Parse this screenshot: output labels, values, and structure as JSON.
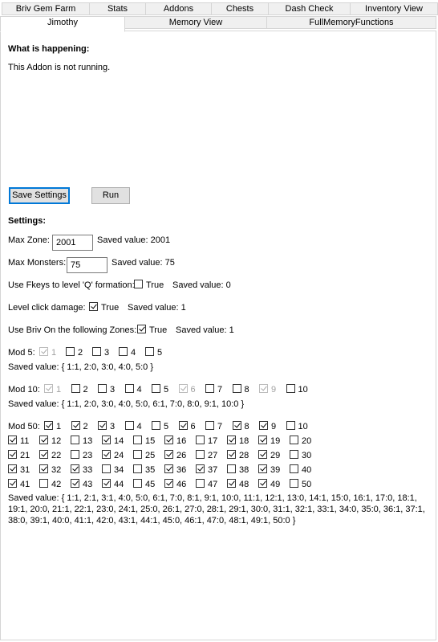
{
  "tabs_row1": [
    "Briv Gem Farm",
    "Stats",
    "Addons",
    "Chests",
    "Dash Check",
    "Inventory View"
  ],
  "tabs_row2": [
    "Jimothy",
    "Memory View",
    "FullMemoryFunctions"
  ],
  "status": {
    "heading": "What is happening:",
    "message": "This Addon is not running."
  },
  "buttons": {
    "save": "Save Settings",
    "run": "Run"
  },
  "settings": {
    "heading": "Settings:",
    "max_zone": {
      "label": "Max Zone:",
      "value": "2001",
      "saved": "Saved value: 2001"
    },
    "max_monsters": {
      "label": "Max Monsters:",
      "value": "75",
      "saved": "Saved value: 75"
    },
    "fkeys": {
      "label": "Use Fkeys to level 'Q' formation:",
      "checkbox_label": "True",
      "checked": false,
      "saved": "Saved value: 0"
    },
    "click_damage": {
      "label": "Level click damage:",
      "checkbox_label": "True",
      "checked": true,
      "saved": "Saved value: 1"
    },
    "briv_zones": {
      "label": "Use Briv On the following Zones:",
      "checkbox_label": "True",
      "checked": true,
      "saved": "Saved value: 1"
    }
  },
  "mod5": {
    "label": "Mod 5:",
    "items": [
      {
        "n": "1",
        "checked": true,
        "disabled": true
      },
      {
        "n": "2",
        "checked": false
      },
      {
        "n": "3",
        "checked": false
      },
      {
        "n": "4",
        "checked": false
      },
      {
        "n": "5",
        "checked": false
      }
    ],
    "saved": "Saved value: { 1:1, 2:0, 3:0, 4:0, 5:0 }"
  },
  "mod10": {
    "label": "Mod 10:",
    "items": [
      {
        "n": "1",
        "checked": true,
        "disabled": true
      },
      {
        "n": "2",
        "checked": false
      },
      {
        "n": "3",
        "checked": false
      },
      {
        "n": "4",
        "checked": false
      },
      {
        "n": "5",
        "checked": false
      },
      {
        "n": "6",
        "checked": true,
        "disabled": true
      },
      {
        "n": "7",
        "checked": false
      },
      {
        "n": "8",
        "checked": false
      },
      {
        "n": "9",
        "checked": true,
        "disabled": true
      },
      {
        "n": "10",
        "checked": false
      }
    ],
    "saved": "Saved value: { 1:1, 2:0, 3:0, 4:0, 5:0, 6:1, 7:0, 8:0, 9:1, 10:0 }"
  },
  "mod50": {
    "label": "Mod 50:",
    "rows": [
      [
        {
          "n": "1",
          "checked": true
        },
        {
          "n": "2",
          "checked": true
        },
        {
          "n": "3",
          "checked": true
        },
        {
          "n": "4",
          "checked": false
        },
        {
          "n": "5",
          "checked": false
        },
        {
          "n": "6",
          "checked": true
        },
        {
          "n": "7",
          "checked": false
        },
        {
          "n": "8",
          "checked": true
        },
        {
          "n": "9",
          "checked": true
        },
        {
          "n": "10",
          "checked": false
        }
      ],
      [
        {
          "n": "11",
          "checked": true
        },
        {
          "n": "12",
          "checked": true
        },
        {
          "n": "13",
          "checked": false
        },
        {
          "n": "14",
          "checked": true
        },
        {
          "n": "15",
          "checked": false
        },
        {
          "n": "16",
          "checked": true
        },
        {
          "n": "17",
          "checked": false
        },
        {
          "n": "18",
          "checked": true
        },
        {
          "n": "19",
          "checked": true
        },
        {
          "n": "20",
          "checked": false
        }
      ],
      [
        {
          "n": "21",
          "checked": true
        },
        {
          "n": "22",
          "checked": true
        },
        {
          "n": "23",
          "checked": false
        },
        {
          "n": "24",
          "checked": true
        },
        {
          "n": "25",
          "checked": false
        },
        {
          "n": "26",
          "checked": true
        },
        {
          "n": "27",
          "checked": false
        },
        {
          "n": "28",
          "checked": true
        },
        {
          "n": "29",
          "checked": true
        },
        {
          "n": "30",
          "checked": false
        }
      ],
      [
        {
          "n": "31",
          "checked": true
        },
        {
          "n": "32",
          "checked": true
        },
        {
          "n": "33",
          "checked": true
        },
        {
          "n": "34",
          "checked": false
        },
        {
          "n": "35",
          "checked": false
        },
        {
          "n": "36",
          "checked": true
        },
        {
          "n": "37",
          "checked": true
        },
        {
          "n": "38",
          "checked": false
        },
        {
          "n": "39",
          "checked": true
        },
        {
          "n": "40",
          "checked": false
        }
      ],
      [
        {
          "n": "41",
          "checked": true
        },
        {
          "n": "42",
          "checked": false
        },
        {
          "n": "43",
          "checked": true
        },
        {
          "n": "44",
          "checked": true
        },
        {
          "n": "45",
          "checked": false
        },
        {
          "n": "46",
          "checked": true
        },
        {
          "n": "47",
          "checked": false
        },
        {
          "n": "48",
          "checked": true
        },
        {
          "n": "49",
          "checked": true
        },
        {
          "n": "50",
          "checked": false
        }
      ]
    ],
    "saved": "Saved value: { 1:1, 2:1, 3:1, 4:0, 5:0, 6:1, 7:0, 8:1, 9:1, 10:0, 11:1, 12:1, 13:0, 14:1, 15:0, 16:1, 17:0, 18:1, 19:1, 20:0, 21:1, 22:1, 23:0, 24:1, 25:0, 26:1, 27:0, 28:1, 29:1, 30:0, 31:1, 32:1, 33:1, 34:0, 35:0, 36:1, 37:1, 38:0, 39:1, 40:0, 41:1, 42:0, 43:1, 44:1, 45:0, 46:1, 47:0, 48:1, 49:1, 50:0 }"
  }
}
